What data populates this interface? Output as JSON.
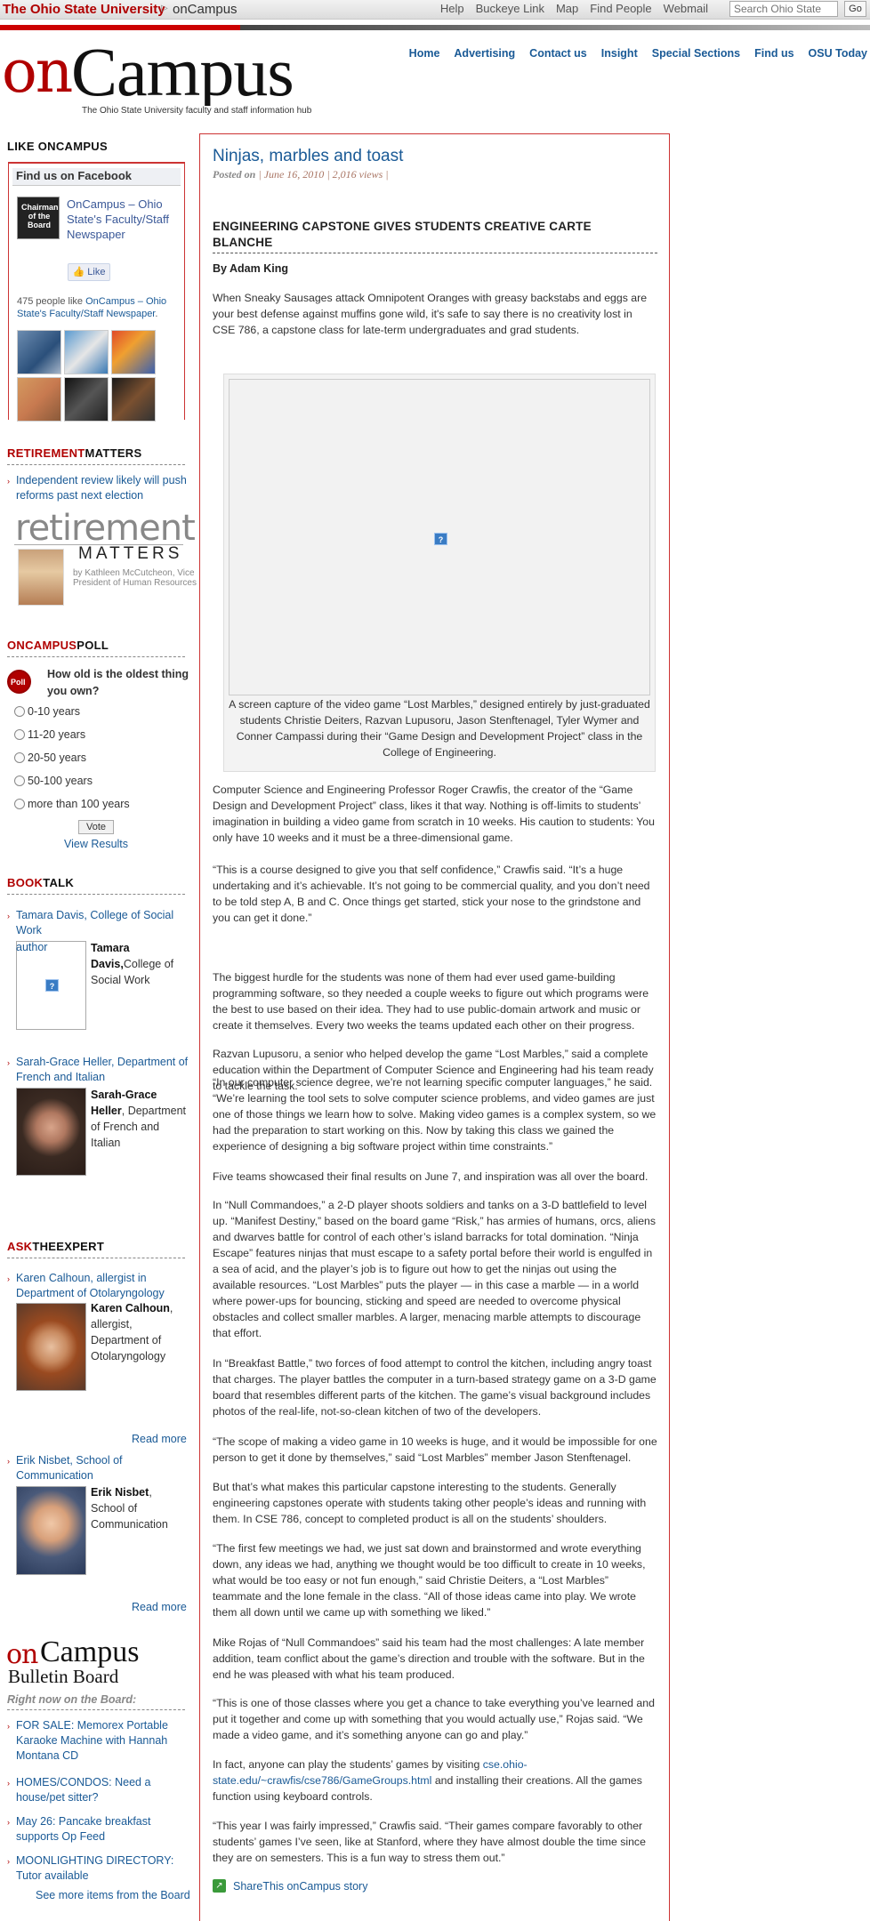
{
  "topbar": {
    "university": "The Ohio State University",
    "site": "onCampus",
    "links": [
      "Help",
      "Buckeye Link",
      "Map",
      "Find People",
      "Webmail"
    ],
    "search_placeholder": "Search Ohio State",
    "go_label": "Go"
  },
  "masthead": {
    "logo_on": "on",
    "logo_campus": "Campus",
    "tagline": "The Ohio State University faculty and staff information hub",
    "nav": [
      "Home",
      "Advertising",
      "Contact us",
      "Insight",
      "Special Sections",
      "Find us",
      "OSU Today"
    ]
  },
  "sidebar": {
    "like_heading": "LIKE ONCAMPUS",
    "facebook": {
      "box_title": "Find us on Facebook",
      "avatar_text": "Chairman of the Board",
      "page_name": "OnCampus – Ohio State's Faculty/Staff Newspaper",
      "like_label": "Like",
      "count_text": "475 people like",
      "count_link": "OnCampus – Ohio State's Faculty/Staff Newspaper",
      "count_end": "."
    },
    "retirement": {
      "heading_red": "RETIREMENT",
      "heading_black": "MATTERS",
      "link": "Independent review likely will push reforms past next election",
      "banner_title": "retirement",
      "banner_matters": "MATTERS",
      "banner_by": "by Kathleen McCutcheon, Vice President of Human Resources"
    },
    "poll": {
      "heading_red": "ONCAMPUS",
      "heading_black": "POLL",
      "icon_label": "Poll",
      "question": "How old is the oldest thing you own?",
      "options": [
        "0-10 years",
        "11-20 years",
        "20-50 years",
        "50-100 years",
        "more than 100 years"
      ],
      "vote_label": "Vote",
      "results_label": "View Results"
    },
    "booktalk": {
      "heading_red": "BOOK",
      "heading_black": "TALK",
      "items": [
        {
          "link": "Tamara Davis, College of Social Work",
          "img_alt": "author",
          "name": "Tamara Davis,",
          "detail": "College of Social Work"
        },
        {
          "link": "Sarah-Grace Heller, Department of French and Italian",
          "name": "Sarah-Grace Heller",
          "detail": ", Department of French and Italian"
        }
      ]
    },
    "expert": {
      "heading_red": "ASK",
      "heading_mid": "THE",
      "heading_black": "EXPERT",
      "items": [
        {
          "link": "Karen Calhoun, allergist in Department of Otolaryngology",
          "name": "Karen Calhoun",
          "detail": ", allergist, Department of Otolaryngology",
          "read_more": "Read more"
        },
        {
          "link": "Erik Nisbet, School of Communication",
          "name": "Erik Nisbet",
          "detail": ", School of Communication",
          "read_more": "Read more"
        }
      ]
    },
    "bulletin": {
      "logo_on": "on",
      "logo_campus": "Campus",
      "logo_sub": "Bulletin Board",
      "right_now": "Right now on the Board:",
      "items": [
        "FOR SALE: Memorex Portable Karaoke Machine with Hannah Montana CD",
        "HOMES/CONDOS: Need a house/pet sitter?",
        "May 26: Pancake breakfast supports Op Feed",
        "MOONLIGHTING DIRECTORY: Tutor available"
      ],
      "see_more": "See more items from the Board"
    }
  },
  "article": {
    "title": "Ninjas, marbles and toast",
    "posted_on": "Posted on",
    "date": "June 16, 2010",
    "views": "2,016 views",
    "sep": "|",
    "kicker": "ENGINEERING CAPSTONE GIVES STUDENTS CREATIVE CARTE BLANCHE",
    "byline": "By Adam King",
    "intro": "When Sneaky Sausages attack Omnipotent Oranges with greasy backstabs and eggs are your best defense against muffins gone wild, it's safe to say there is no creativity lost in CSE 786, a capstone class for late-term undergraduates and grad students.",
    "caption": "A screen capture of the video game “Lost Marbles,” designed entirely by just-graduated students Christie Deiters, Razvan Lupusoru, Jason Stenftenagel, Tyler Wymer and Conner Campassi during their “Game Design and Development Project” class in the College of Engineering.",
    "paragraphs": [
      "Computer Science and Engineering Professor Roger Crawfis, the creator of the “Game Design and Development Project” class, likes it that way. Nothing is off-limits to students’ imagination in building a video game from scratch in 10 weeks. His caution to students: You only have 10 weeks and it must be a three-dimensional game.",
      "“This is a course designed to give you that self confidence,” Crawfis said. “It’s a huge undertaking and it’s achievable. It’s not going to be commercial quality, and you don’t need to be told step A, B and C. Once things get started, stick your nose to the grindstone and you can get it done.”",
      "The biggest hurdle for the students was none of them had ever used game-building programming software, so they needed a couple weeks to figure out which programs were the best to use based on their idea. They had to use public-domain artwork and music or create it themselves. Every two weeks the teams updated each other on their progress.",
      "Razvan Lupusoru, a senior who helped develop the game “Lost Marbles,” said a complete education within the Department of Computer Science and Engineering had his team ready to tackle the task.",
      "“In our computer science degree, we’re not learning specific computer languages,” he said. “We’re learning the tool sets to solve computer science problems, and video games are just one of those things we learn how to solve. Making video games is a complex system, so we had the preparation to start working on this. Now by taking this class we gained the experience of designing a big software project within time constraints.”",
      "Five teams showcased their final results on June 7, and inspiration was all over the board.",
      "In “Null Commandoes,” a 2-D player shoots soldiers and tanks on a 3-D battlefield to level up. “Manifest Destiny,” based on the board game “Risk,” has armies of humans, orcs, aliens and dwarves battle for control of each other’s island barracks for total domination. “Ninja Escape” features ninjas that must escape to a safety portal before their world is engulfed in a sea of acid, and the player’s job is to figure out how to get the ninjas out using the available resources. “Lost Marbles” puts the player — in this case a marble — in a world where power-ups for bouncing, sticking and speed are needed to overcome physical obstacles and collect smaller marbles. A larger, menacing marble attempts to discourage that effort.",
      "In “Breakfast Battle,” two forces of food attempt to control the kitchen, including angry toast that charges. The player battles the computer in a turn-based strategy game on a 3-D game board that resembles different parts of the kitchen. The game’s visual background includes photos of the real-life, not-so-clean kitchen of two of the developers.",
      "“The scope of making a video game in 10 weeks is huge, and it would be impossible for one person to get it done by themselves,” said “Lost Marbles” member Jason Stenftenagel.",
      "But that’s what makes this particular capstone interesting to the students. Generally engineering capstones operate with students taking other people’s ideas and running with them. In CSE 786, concept to completed product is all on the students’ shoulders.",
      "“The first few meetings we had, we just sat down and brainstormed and wrote everything down, any ideas we had, anything we thought would be too difficult to create in 10 weeks, what would be too easy or not fun enough,” said Christie Deiters, a “Lost Marbles” teammate and the lone female in the class. “All of those ideas came into play. We wrote them all down until we came up with something we liked.”",
      "Mike Rojas of “Null Commandoes” said his team had the most challenges: A late member addition, team conflict about the game’s direction and trouble with the software. But in the end he was pleased with what his team produced.",
      "“This is one of those classes where you get a chance to take everything you’ve learned and put it together and come up with something that you would actually use,” Rojas said. “We made a video game, and it’s something anyone can go and play.”"
    ],
    "games_pre": "In fact, anyone can play the students’ games by visiting",
    "games_link": "cse.ohio-state.edu/~crawfis/cse786/GameGroups.html",
    "games_post": "and installing their creations. All the games function using keyboard controls.",
    "closing": "“This year I was fairly impressed,” Crawfis said. “Their games compare favorably to other students’ games I’ve seen, like at Stanford, where they have almost double the time since they are on semesters. This is a fun way to stress them out.”",
    "share_label": "ShareThis onCampus story",
    "broken_image_label": "?"
  }
}
